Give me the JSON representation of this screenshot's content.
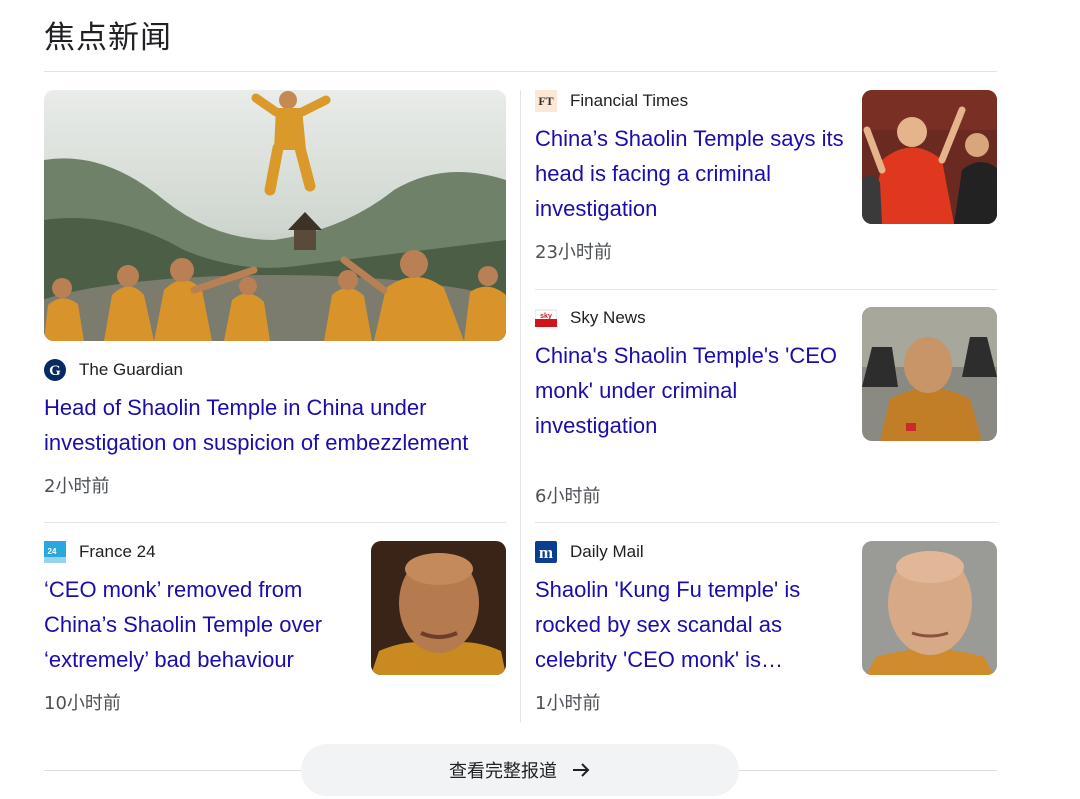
{
  "section_title": "焦点新闻",
  "articles": [
    {
      "source": "The Guardian",
      "logo": "guardian-logo-icon",
      "headline": "Head of Shaolin Temple in China under investigation on suspicion of embezzlement",
      "time": "2小时前",
      "image": "shaolin-monks-training-photo"
    },
    {
      "source": "Financial Times",
      "logo": "ft-logo-icon",
      "logo_text": "FT",
      "headline": "China’s Shaolin Temple says its head is facing a criminal investigation",
      "time": "23小时前",
      "image": "abbot-red-robe-photo"
    },
    {
      "source": "Sky News",
      "logo": "sky-news-logo-icon",
      "logo_text": "sky",
      "headline": "China's Shaolin Temple's 'CEO monk' under criminal investigation",
      "time": "6小时前",
      "image": "monk-portrait-photo"
    },
    {
      "source": "France 24",
      "logo": "france24-logo-icon",
      "logo_text": "24",
      "headline": "‘CEO monk’ removed from China’s Shaolin Temple over ‘extremely’ bad behaviour",
      "time": "10小时前",
      "image": "monk-speaking-photo"
    },
    {
      "source": "Daily Mail",
      "logo": "daily-mail-logo-icon",
      "logo_text": "m",
      "headline": "Shaolin 'Kung Fu temple' is rocked by sex scandal as celebrity 'CEO monk' is…",
      "time": "1小时前",
      "image": "monk-headshot-photo"
    }
  ],
  "more_button": {
    "label": "查看完整报道",
    "icon": "arrow-right-icon"
  },
  "colors": {
    "link": "#1a0dab",
    "divider": "#e3e3e3",
    "button_bg": "#f1f3f4"
  }
}
